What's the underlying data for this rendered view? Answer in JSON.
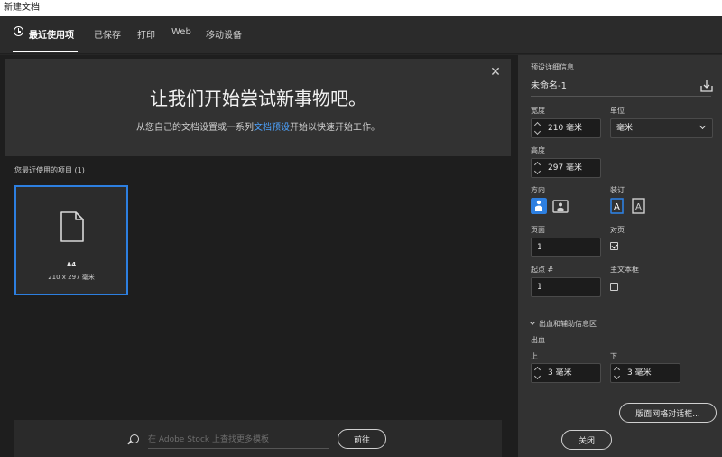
{
  "window": {
    "title": "新建文档"
  },
  "tabs": [
    {
      "label": "最近使用项",
      "active": true
    },
    {
      "label": "已保存"
    },
    {
      "label": "打印"
    },
    {
      "label": "Web"
    },
    {
      "label": "移动设备"
    }
  ],
  "banner": {
    "title": "让我们开始尝试新事物吧。",
    "subtitle_before": "从您自己的文档设置或一系列",
    "subtitle_link": "文档预设",
    "subtitle_after": "开始以快速开始工作。"
  },
  "recent": {
    "label": "您最近使用的项目 (1)",
    "items": [
      {
        "name": "A4",
        "size": "210 x 297 毫米"
      }
    ]
  },
  "search": {
    "placeholder": "在 Adobe Stock 上查找更多模板",
    "go_label": "前往"
  },
  "details": {
    "header": "预设详细信息",
    "doc_name": "未命名-1",
    "width_label": "宽度",
    "width_value": "210 毫米",
    "unit_label": "单位",
    "unit_value": "毫米",
    "height_label": "高度",
    "height_value": "297 毫米",
    "orientation_label": "方向",
    "binding_label": "装订",
    "pages_label": "页面",
    "pages_value": "1",
    "facing_label": "对页",
    "facing_checked": true,
    "start_label": "起点 #",
    "start_value": "1",
    "primary_frame_label": "主文本框",
    "primary_frame_checked": false,
    "bleed_section_label": "出血和辅助信息区",
    "bleed_label": "出血",
    "top_label": "上",
    "top_value": "3 毫米",
    "bottom_label": "下",
    "bottom_value": "3 毫米",
    "preview_button": "版面网格对话框...",
    "close_button": "关闭"
  },
  "colors": {
    "accent": "#2d7fe0",
    "link": "#4da3ff"
  }
}
